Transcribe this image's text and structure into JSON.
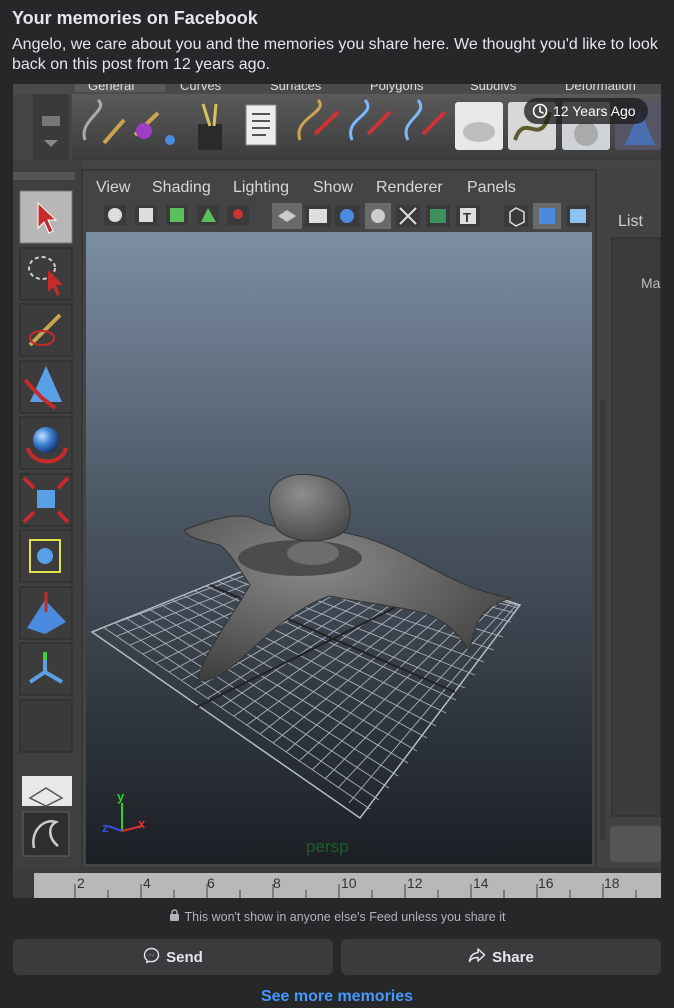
{
  "memory": {
    "title": "Your memories on Facebook",
    "message": "Angelo, we care about you and the memories you share here. We thought you'd like to look back on this post from 12 years ago.",
    "age_badge": "12 Years Ago",
    "privacy_note": "This won't show in anyone else's Feed unless you share it",
    "send_label": "Send",
    "share_label": "Share",
    "see_more_label": "See more memories"
  },
  "maya": {
    "shelf_tabs": [
      "General",
      "Curves",
      "Surfaces",
      "Polygons",
      "Subdivs",
      "Deformation"
    ],
    "panel_menu": [
      "View",
      "Shading",
      "Lighting",
      "Show",
      "Renderer",
      "Panels"
    ],
    "side_panel_label": "List",
    "side_panel_fragment": "Ma",
    "camera_label": "persp",
    "ruler_ticks": [
      "2",
      "4",
      "6",
      "8",
      "10",
      "12",
      "14",
      "16",
      "18"
    ],
    "axis_labels": {
      "x": "x",
      "y": "y",
      "z": "z"
    }
  },
  "icons": {
    "clock": "clock-icon",
    "lock": "lock-icon",
    "messenger": "messenger-icon",
    "share": "share-arrow-icon"
  },
  "colors": {
    "background": "#252728",
    "button": "#3a3b3c",
    "link": "#4599ff",
    "text": "#e4e6eb",
    "muted": "#b0b3b8"
  }
}
